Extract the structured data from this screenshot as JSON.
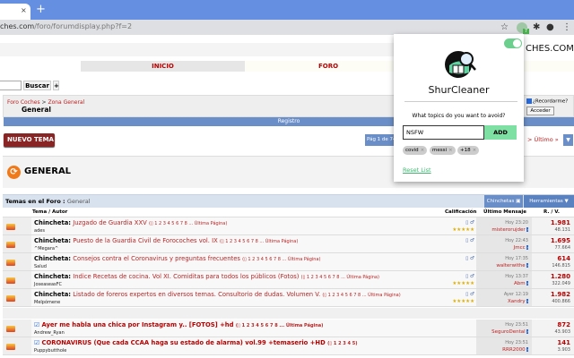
{
  "browser": {
    "url_host": "ches.com",
    "url_path": "/foro/forumdisplay.php?f=2",
    "new_tab": "+",
    "tab_close": "×",
    "star": "☆",
    "ext_badge": "7",
    "puzzle": "✱",
    "profile": "●",
    "menu": "⋮"
  },
  "site": {
    "logo_text": "CHES.COM",
    "nav": {
      "inicio": "INICIO",
      "foro": "FORO"
    },
    "search_button": "Buscar",
    "plus": "+",
    "remember": "¿Recordarme?",
    "login": "Acceder"
  },
  "breadcrumb": {
    "root": "Foro Coches",
    "sep": " > ",
    "parent": "Zona General",
    "current": "General"
  },
  "registro": "Registro",
  "new_thread": "NUEVO TEMA",
  "pagination": {
    "label": "Pág 1 de 74",
    "next": ">  Último »",
    "dropdown": "▼"
  },
  "forum_title": "GENERAL",
  "table": {
    "header": "Temas en el Foro :",
    "header_forum": "General",
    "chinchetas": "Chinchetas ▣",
    "herramientas": "Herramientas ▼",
    "columns": [
      "Tema / Autor",
      "Calificación",
      "Último Mensaje",
      "R. / V."
    ],
    "pinned": [
      {
        "prefix": "Chincheta:",
        "title": "Juzgado de Guardia XXV",
        "pages": "(▯ 1 2 3 4 5 6 7 8 ... Última Página)",
        "author": "ades",
        "stars": "★★★★★",
        "time_day": "Hoy",
        "time": "23:20",
        "last_user": "misterorujder",
        "replies": "1.981",
        "views": "48.131"
      },
      {
        "prefix": "Chincheta:",
        "title": "Puesto de la Guardia Civil de Forocoches vol. IX",
        "pages": "(▯ 1 2 3 4 5 6 7 8 ... Última Página)",
        "author": "^Megara^",
        "stars": "",
        "time_day": "Hoy",
        "time": "22:43",
        "last_user": "Jmcc",
        "replies": "1.695",
        "views": "77.664"
      },
      {
        "prefix": "Chincheta:",
        "title": "Consejos contra el Coronavirus y preguntas frecuentes",
        "pages": "(▯ 1 2 3 4 5 6 7 8 ... Última Página)",
        "author": "Salud",
        "stars": "",
        "time_day": "Hoy",
        "time": "17:35",
        "last_user": "walterwithe",
        "replies": "614",
        "views": "146.815"
      },
      {
        "prefix": "Chincheta:",
        "title": "Indice Recetas de cocina. Vol XI. Comiditas para todos los públicos (Fotos)",
        "pages": "(▯ 1 2 3 4 5 6 7 8 ... Última Página)",
        "author": "JoseaseasFC",
        "stars": "★★★★★",
        "time_day": "Hoy",
        "time": "13:37",
        "last_user": "Abm",
        "replies": "1.280",
        "views": "322.049"
      },
      {
        "prefix": "Chincheta:",
        "title": "Listado de foreros expertos en diversos temas. Consultorio de dudas. Volumen V.",
        "pages": "(▯ 1 2 3 4 5 6 7 8 ... Última Página)",
        "author": "Melpómene",
        "stars": "★★★★★",
        "time_day": "Ayer",
        "time": "12:19",
        "last_user": "Xandry",
        "replies": "1.982",
        "views": "400.866"
      }
    ],
    "threads": [
      {
        "title": "Ayer me habla una chica por Instagram y.. [FOTOS] +hd",
        "pages": "(▯ 1 2 3 4 5 6 7 8 ... Última Página)",
        "author": "Andrew_Ryan",
        "time_day": "Hoy",
        "time": "23:51",
        "last_user": "SeguroDental",
        "replies": "872",
        "views": "43.903"
      },
      {
        "title": "CORONAVIRUS (Que cada CCAA haga su estado de alarma) vol.99 +temaserio +HD",
        "pages": "(▯ 1 2 3 4 5)",
        "author": "Puppybutthole",
        "time_day": "Hoy",
        "time": "23:51",
        "last_user": "RRR2000",
        "replies": "141",
        "views": "3.903"
      }
    ]
  },
  "popup": {
    "enabled": true,
    "brand": "ShurCleaner",
    "question": "What topics do you want to avoid?",
    "input_value": "NSFW",
    "add_button": "ADD",
    "tags": [
      "covid",
      "messi",
      "+18"
    ],
    "tag_remove": "×",
    "reset": "Reset List",
    "accent": "#7fe0a4"
  }
}
